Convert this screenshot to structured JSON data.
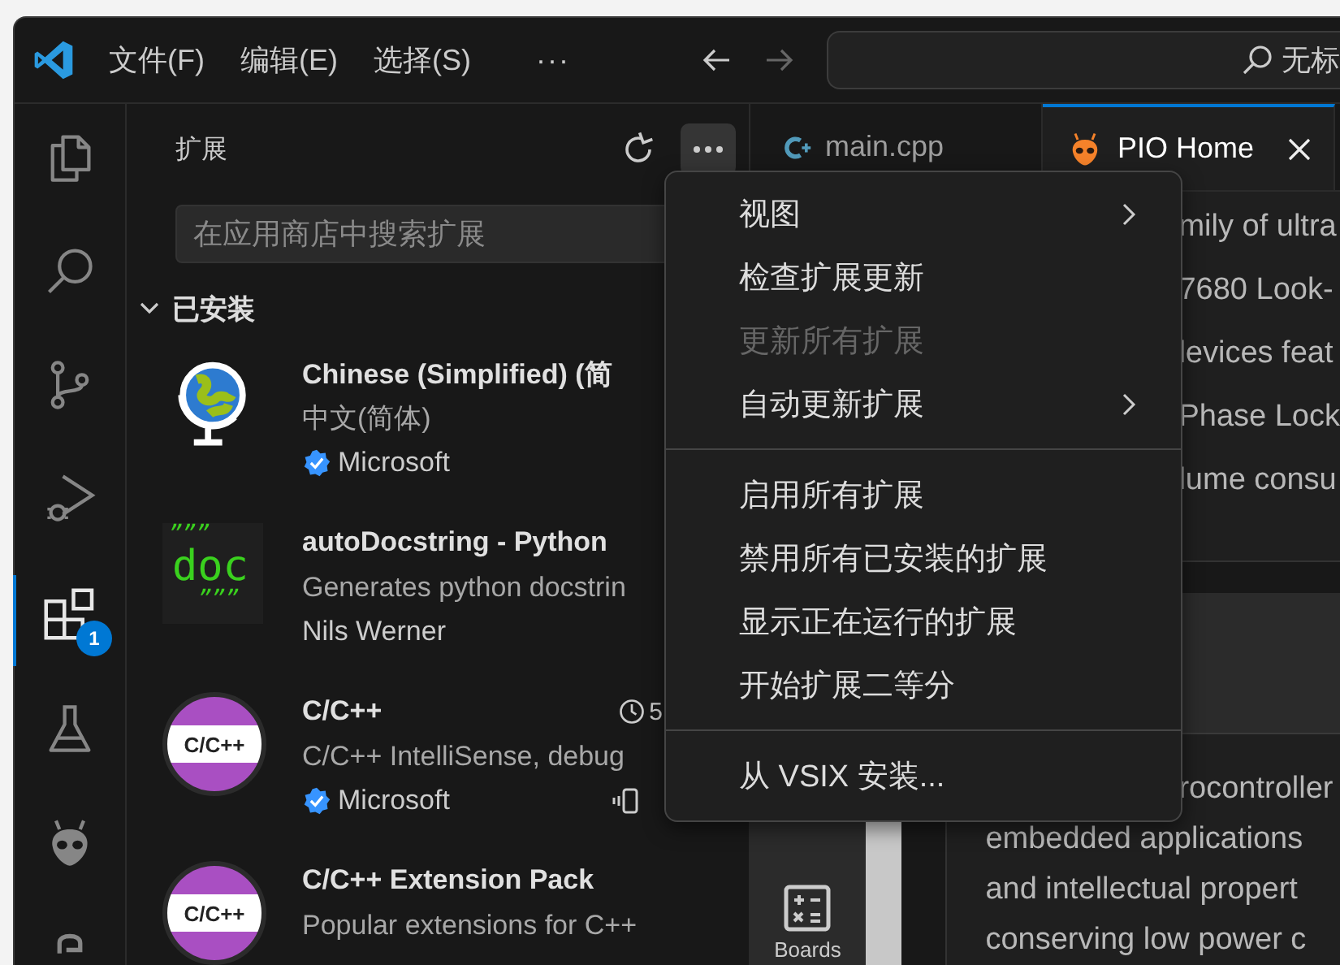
{
  "title_bar": {
    "menus": [
      "文件(F)",
      "编辑(E)",
      "选择(S)"
    ],
    "overflow": "···",
    "command_center": "无标"
  },
  "activity_bar": {
    "items": [
      {
        "kind": "files",
        "selected": false
      },
      {
        "kind": "search",
        "selected": false
      },
      {
        "kind": "source-control",
        "selected": false
      },
      {
        "kind": "run-debug",
        "selected": false
      },
      {
        "kind": "extensions",
        "selected": true,
        "badge": "1"
      },
      {
        "kind": "testing",
        "selected": false
      },
      {
        "kind": "alien",
        "selected": false
      },
      {
        "kind": "python",
        "selected": false
      }
    ]
  },
  "sidebar": {
    "title": "扩展",
    "search": {
      "placeholder": "在应用商店中搜索扩展"
    },
    "section": {
      "title": "已安装",
      "expanded": true
    },
    "extensions": [
      {
        "kind": "globe",
        "name": "Chinese (Simplified) (简",
        "description": "中文(简体)",
        "publisher": "Microsoft",
        "verified": true,
        "actions": false
      },
      {
        "kind": "doc",
        "icon_lines": [
          "”””",
          "doc",
          "”””"
        ],
        "name": "autoDocstring - Python",
        "description": "Generates python docstrin",
        "publisher": "Nils Werner",
        "verified": false,
        "actions": false
      },
      {
        "kind": "cpp",
        "icon_lines": [
          "C/C++"
        ],
        "name": "C/C++",
        "activation_time": "5",
        "description": "C/C++ IntelliSense, debug",
        "publisher": "Microsoft",
        "verified": true,
        "actions": true
      },
      {
        "kind": "cpp",
        "icon_lines": [
          "C/C++"
        ],
        "name": "C/C++ Extension Pack",
        "description": "Popular extensions for C++",
        "verified": false,
        "actions": false
      }
    ]
  },
  "editor": {
    "tabs": [
      {
        "kind": "cpp",
        "label": "main.cpp",
        "selected": false,
        "closable": false
      },
      {
        "kind": "pio",
        "label": "PIO Home",
        "selected": true,
        "closable": true
      }
    ],
    "nav": {
      "label": "Boards"
    },
    "upper_lines": [
      "mily of ultra",
      "7680 Look-",
      "levices feat",
      "Phase Lock",
      "lume consu"
    ],
    "lower_lines": [
      "rocontroller",
      "embedded applications",
      "and intellectual propert",
      "conserving low power c"
    ]
  },
  "menu": {
    "items": [
      {
        "kind": "item",
        "label": "视图",
        "disabled": false,
        "submenu": true
      },
      {
        "kind": "item",
        "label": "检查扩展更新",
        "disabled": false,
        "submenu": false
      },
      {
        "kind": "item",
        "label": "更新所有扩展",
        "disabled": true,
        "submenu": false
      },
      {
        "kind": "item",
        "label": "自动更新扩展",
        "disabled": false,
        "submenu": true
      },
      {
        "kind": "separator"
      },
      {
        "kind": "item",
        "label": "启用所有扩展",
        "disabled": false,
        "submenu": false
      },
      {
        "kind": "item",
        "label": "禁用所有已安装的扩展",
        "disabled": false,
        "submenu": false
      },
      {
        "kind": "item",
        "label": "显示正在运行的扩展",
        "disabled": false,
        "submenu": false
      },
      {
        "kind": "item",
        "label": "开始扩展二等分",
        "disabled": false,
        "submenu": false
      },
      {
        "kind": "separator"
      },
      {
        "kind": "item",
        "label": "从 VSIX 安装...",
        "disabled": false,
        "submenu": false
      }
    ]
  }
}
